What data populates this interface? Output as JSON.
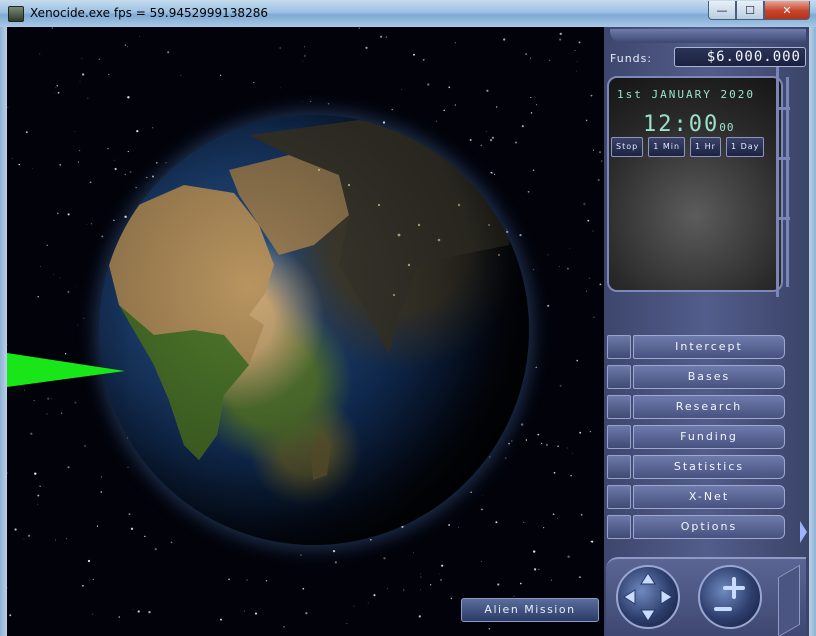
{
  "window": {
    "title": "Xenocide.exe  fps = 59.9452999138286",
    "controls": {
      "minimize": "—",
      "maximize": "☐",
      "close": "✕"
    }
  },
  "geoscape": {
    "alien_mission_button": "Alien Mission",
    "beam_color": "#19e619"
  },
  "panel": {
    "funds_label": "Funds:",
    "funds_value": "$6.000.000",
    "date": "1st JANUARY 2020",
    "time_main": "12:00",
    "time_seconds": "00",
    "speed_buttons": [
      "Stop",
      "1 Min",
      "1 Hr",
      "1 Day"
    ],
    "menu": [
      "Intercept",
      "Bases",
      "Research",
      "Funding",
      "Statistics",
      "X-Net",
      "Options"
    ],
    "accent_color": "#9be2cc"
  }
}
